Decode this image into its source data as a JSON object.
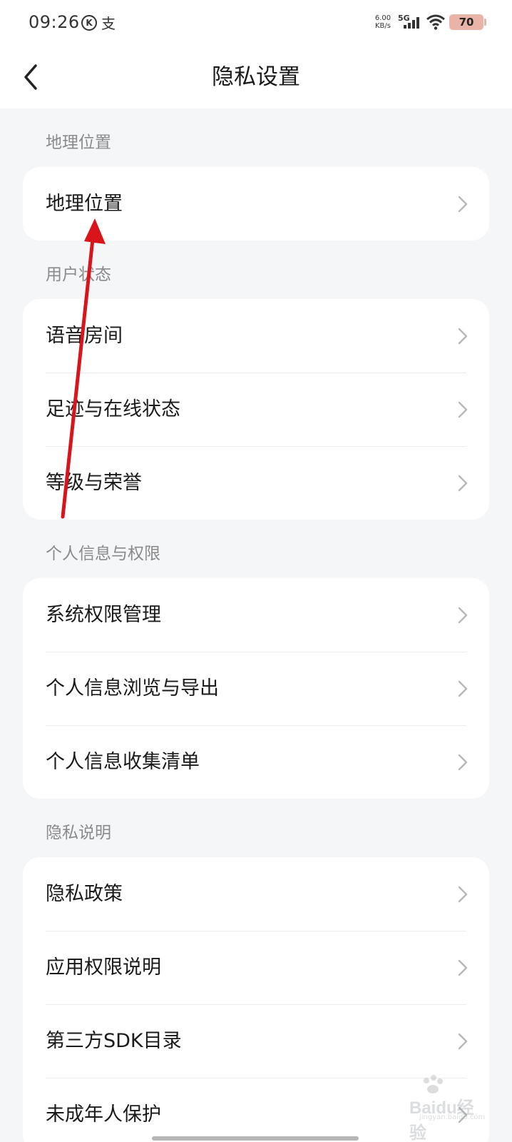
{
  "status_bar": {
    "time": "09:26",
    "k_icon_letter": "K",
    "pay_icon_glyph": "支",
    "net_speed_value": "6.00",
    "net_speed_unit": "KB/s",
    "network": "5G",
    "battery": "70"
  },
  "nav": {
    "title": "隐私设置"
  },
  "sections": [
    {
      "header": "地理位置",
      "items": [
        {
          "label": "地理位置"
        }
      ]
    },
    {
      "header": "用户状态",
      "items": [
        {
          "label": "语音房间"
        },
        {
          "label": "足迹与在线状态"
        },
        {
          "label": "等级与荣誉"
        }
      ]
    },
    {
      "header": "个人信息与权限",
      "items": [
        {
          "label": "系统权限管理"
        },
        {
          "label": "个人信息浏览与导出"
        },
        {
          "label": "个人信息收集清单"
        }
      ]
    },
    {
      "header": "隐私说明",
      "items": [
        {
          "label": "隐私政策"
        },
        {
          "label": "应用权限说明"
        },
        {
          "label": "第三方SDK目录"
        },
        {
          "label": "未成年人保护"
        }
      ]
    }
  ],
  "annotation": {
    "arrow_color": "#d9141b"
  },
  "watermark": {
    "text": "Baidu经验",
    "sub": "jingyan.baidu.com"
  },
  "colors": {
    "background": "#f5f6f8",
    "card": "#ffffff",
    "section_header": "#8a8a8a",
    "chevron": "#b8b8b8"
  }
}
